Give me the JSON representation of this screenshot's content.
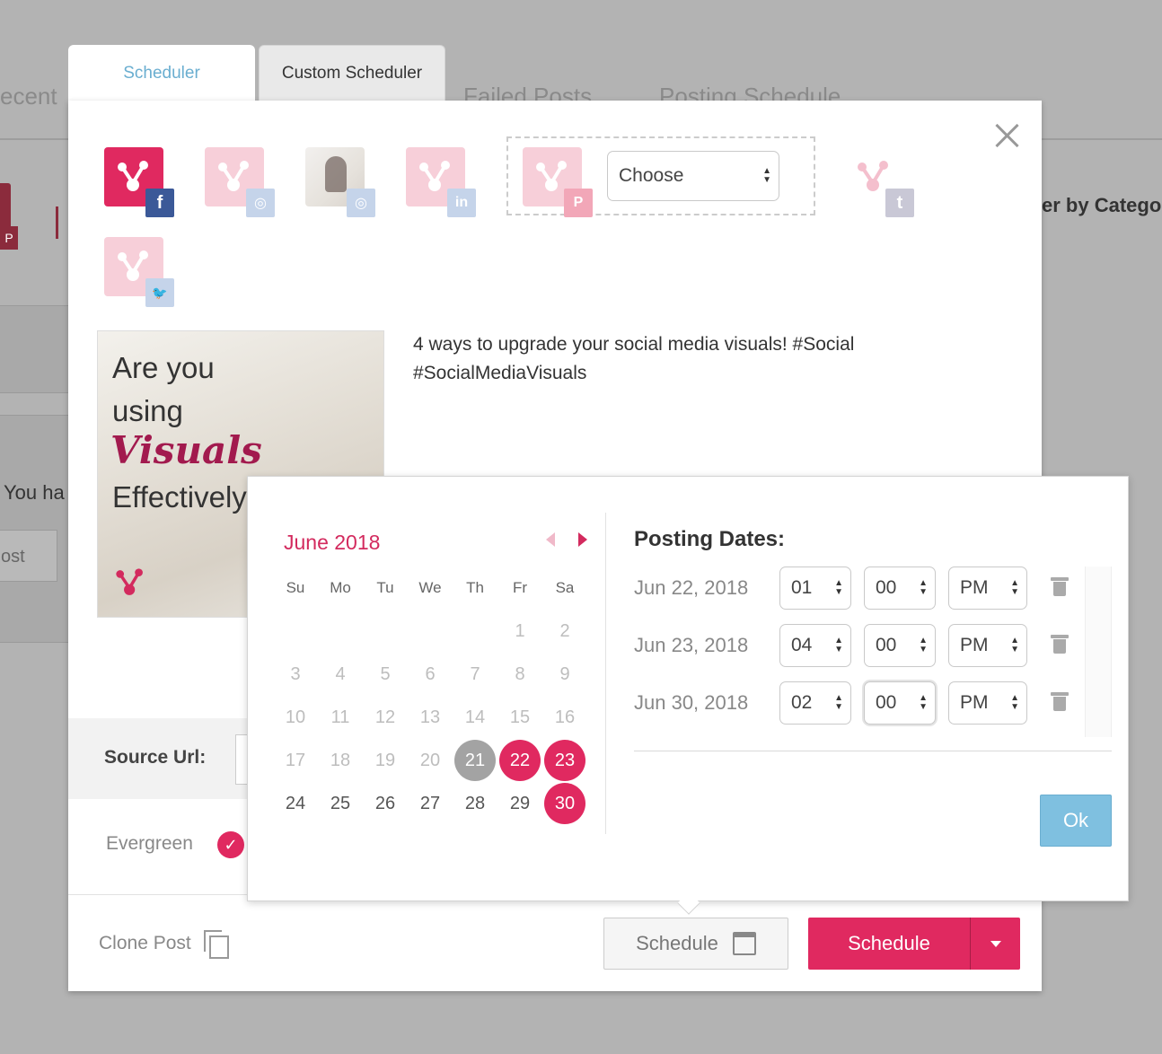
{
  "background": {
    "tabs": [
      "ecent",
      "Failed Posts",
      "Posting Schedule"
    ],
    "filter_text": "er by Catego",
    "message_text": "You ha",
    "button_text": "ost"
  },
  "modal": {
    "tabs": [
      {
        "label": "Scheduler",
        "active": true
      },
      {
        "label": "Custom Scheduler",
        "active": false
      }
    ],
    "accounts": [
      {
        "network": "facebook",
        "badge": "f",
        "selected": true
      },
      {
        "network": "instagram",
        "badge": "◎",
        "selected": false
      },
      {
        "network": "instagram-photo",
        "badge": "◎",
        "selected": false
      },
      {
        "network": "linkedin",
        "badge": "in",
        "selected": false
      },
      {
        "network": "pinterest",
        "badge": "P",
        "selected": false
      },
      {
        "network": "tumblr",
        "badge": "t",
        "selected": false
      },
      {
        "network": "twitter",
        "badge": "🐦",
        "selected": false
      }
    ],
    "board_select": {
      "value": "Choose"
    },
    "post_image": {
      "line1": "Are you",
      "line2": "using",
      "line3": "Visuals",
      "line4": "Effectively"
    },
    "caption": "4 ways to upgrade your social media visuals! #Social #SocialMediaVisuals",
    "source_url_label": "Source Url:",
    "evergreen_label": "Evergreen",
    "evergreen_checked": true,
    "clone_label": "Clone Post",
    "schedule_ghost_label": "Schedule",
    "schedule_button_label": "Schedule",
    "brand_color": "#e02960",
    "accent_color": "#6aaed0"
  },
  "calendar": {
    "month_label": "June 2018",
    "weekdays": [
      "Su",
      "Mo",
      "Tu",
      "We",
      "Th",
      "Fr",
      "Sa"
    ],
    "leading_blanks": 5,
    "days_in_month": 30,
    "today": 21,
    "selected": [
      22,
      23,
      30
    ],
    "first_selectable": 21
  },
  "posting_dates": {
    "title": "Posting Dates:",
    "rows": [
      {
        "date": "Jun 22, 2018",
        "hour": "01",
        "minute": "00",
        "ampm": "PM"
      },
      {
        "date": "Jun 23, 2018",
        "hour": "04",
        "minute": "00",
        "ampm": "PM"
      },
      {
        "date": "Jun 30, 2018",
        "hour": "02",
        "minute": "00",
        "ampm": "PM"
      }
    ],
    "ok_label": "Ok"
  }
}
